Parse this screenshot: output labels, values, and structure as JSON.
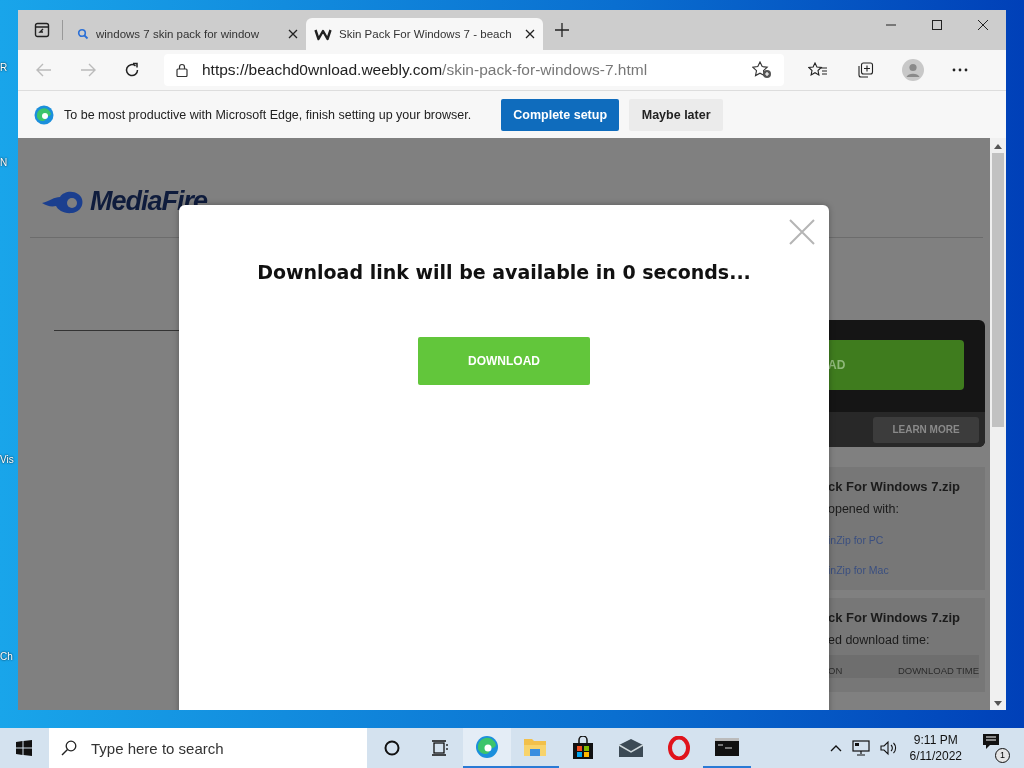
{
  "desktop": {
    "icon_labels": [
      "R",
      "N",
      "Vis",
      "Ch"
    ]
  },
  "browser": {
    "tabs": [
      {
        "title": "windows 7 skin pack for window",
        "kind": "search",
        "selected": false
      },
      {
        "title": "Skin Pack For Windows 7 - beach",
        "kind": "weebly",
        "selected": true
      }
    ],
    "address": {
      "host": "https://beachd0wnload.weebly.com",
      "path": "/skin-pack-for-windows-7.html"
    },
    "infobar": {
      "message": "To be most productive with Microsoft Edge, finish setting up your browser.",
      "primary": "Complete setup",
      "secondary": "Maybe later"
    }
  },
  "page": {
    "logo": "MediaFire",
    "download_button": "AD",
    "learn_more": "LEARN MORE",
    "cards": [
      {
        "title": "ck For Windows 7.zip",
        "subtitle": "opened with:",
        "links": [
          "inZip for PC",
          "inZip for Mac"
        ]
      },
      {
        "title": "ck For Windows 7.zip",
        "subtitle": "ed download time:",
        "columns": [
          "ON",
          "DOWNLOAD TIME"
        ]
      }
    ]
  },
  "modal": {
    "title": "Download link will be available in 0 seconds...",
    "button": "DOWNLOAD"
  },
  "taskbar": {
    "search_placeholder": "Type here to search",
    "apps": [
      {
        "kind": "edge",
        "running": true,
        "selected": true
      },
      {
        "kind": "explorer",
        "running": true,
        "selected": false
      },
      {
        "kind": "store",
        "running": false,
        "selected": false
      },
      {
        "kind": "mail",
        "running": false,
        "selected": false
      },
      {
        "kind": "opera",
        "running": false,
        "selected": false
      },
      {
        "kind": "terminal",
        "running": true,
        "selected": false
      }
    ],
    "time": "9:11 PM",
    "date": "6/11/2022",
    "notification_count": "1"
  }
}
